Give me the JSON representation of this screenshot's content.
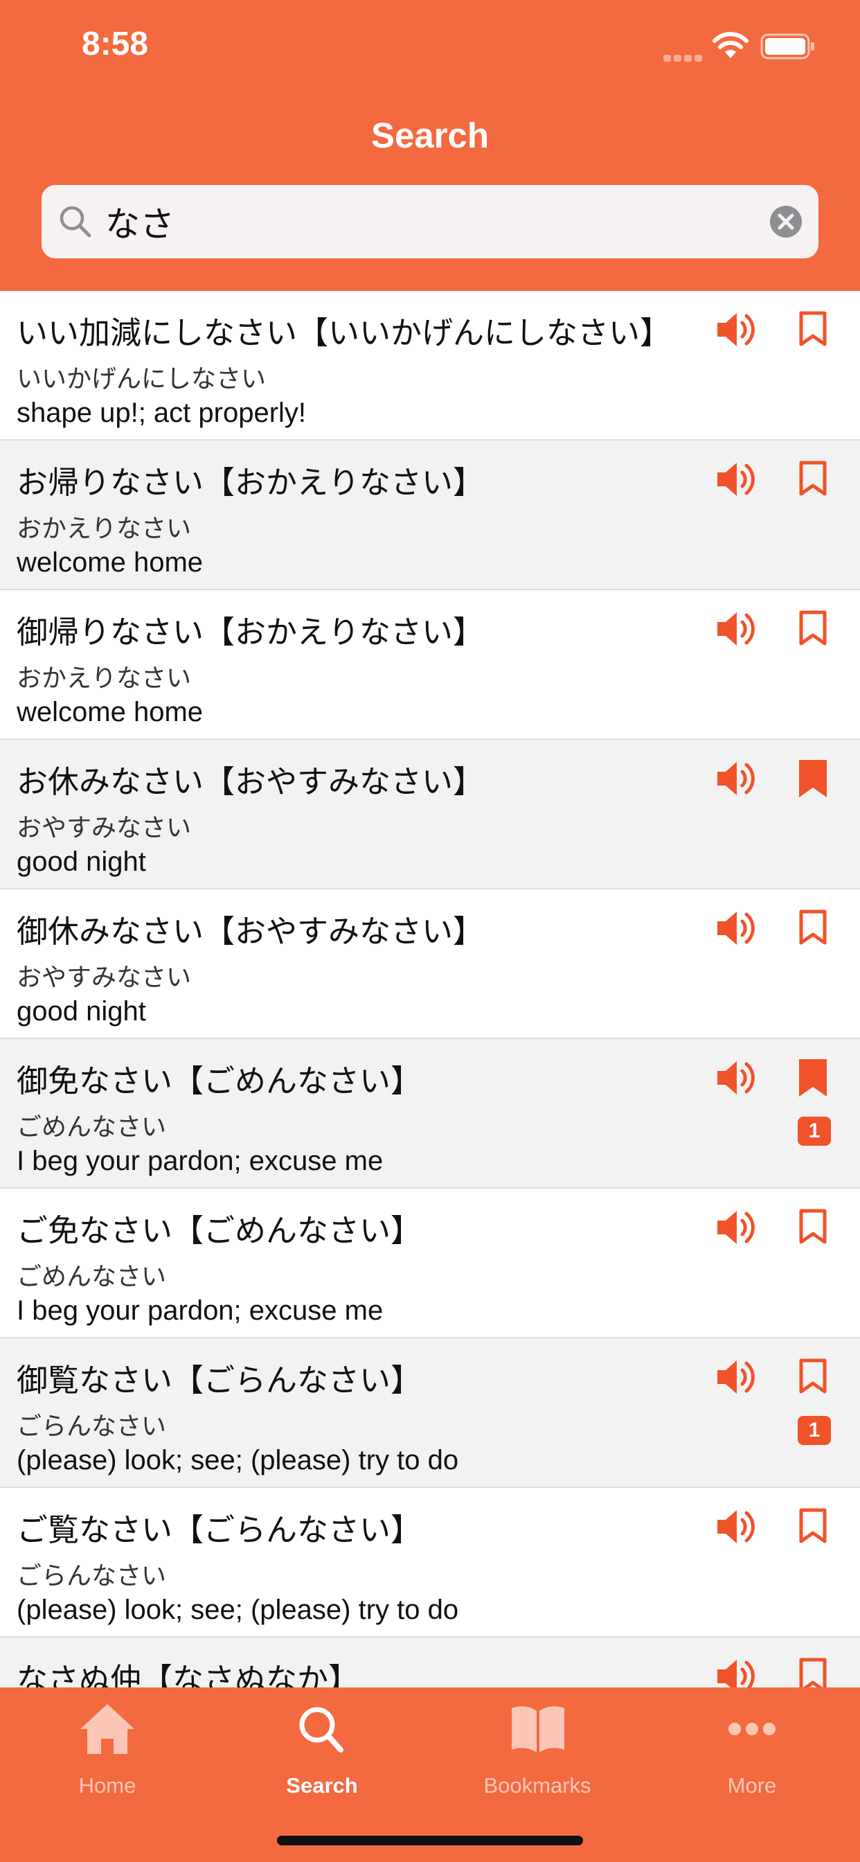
{
  "status_bar": {
    "time": "8:58"
  },
  "nav": {
    "title": "Search"
  },
  "search": {
    "value": "なさ",
    "placeholder": ""
  },
  "colors": {
    "accent": "#F46A40",
    "icon": "#F0532A",
    "alt_row": "#F2F2F2"
  },
  "entries": [
    {
      "title": "いい加減にしなさい【いいかげんにしなさい】",
      "reading": "いいかげんにしなさい",
      "meaning": "shape up!; act properly!",
      "bookmarked": false,
      "badge": ""
    },
    {
      "title": "お帰りなさい【おかえりなさい】",
      "reading": "おかえりなさい",
      "meaning": "welcome home",
      "bookmarked": false,
      "badge": ""
    },
    {
      "title": "御帰りなさい【おかえりなさい】",
      "reading": "おかえりなさい",
      "meaning": "welcome home",
      "bookmarked": false,
      "badge": ""
    },
    {
      "title": "お休みなさい【おやすみなさい】",
      "reading": "おやすみなさい",
      "meaning": "good night",
      "bookmarked": true,
      "badge": ""
    },
    {
      "title": "御休みなさい【おやすみなさい】",
      "reading": "おやすみなさい",
      "meaning": "good night",
      "bookmarked": false,
      "badge": ""
    },
    {
      "title": "御免なさい【ごめんなさい】",
      "reading": "ごめんなさい",
      "meaning": "I beg your pardon; excuse me",
      "bookmarked": true,
      "badge": "1"
    },
    {
      "title": "ご免なさい【ごめんなさい】",
      "reading": "ごめんなさい",
      "meaning": "I beg your pardon; excuse me",
      "bookmarked": false,
      "badge": ""
    },
    {
      "title": "御覧なさい【ごらんなさい】",
      "reading": "ごらんなさい",
      "meaning": "(please) look; see; (please) try to do",
      "bookmarked": false,
      "badge": "1"
    },
    {
      "title": "ご覧なさい【ごらんなさい】",
      "reading": "ごらんなさい",
      "meaning": "(please) look; see; (please) try to do",
      "bookmarked": false,
      "badge": ""
    },
    {
      "title": "なさぬ仲【なさぬなか】",
      "reading": "",
      "meaning": "",
      "bookmarked": false,
      "badge": ""
    }
  ],
  "tabs": [
    {
      "label": "Home",
      "icon": "home-icon",
      "active": false
    },
    {
      "label": "Search",
      "icon": "search-icon",
      "active": true
    },
    {
      "label": "Bookmarks",
      "icon": "bookmarks-icon",
      "active": false
    },
    {
      "label": "More",
      "icon": "more-icon",
      "active": false
    }
  ]
}
